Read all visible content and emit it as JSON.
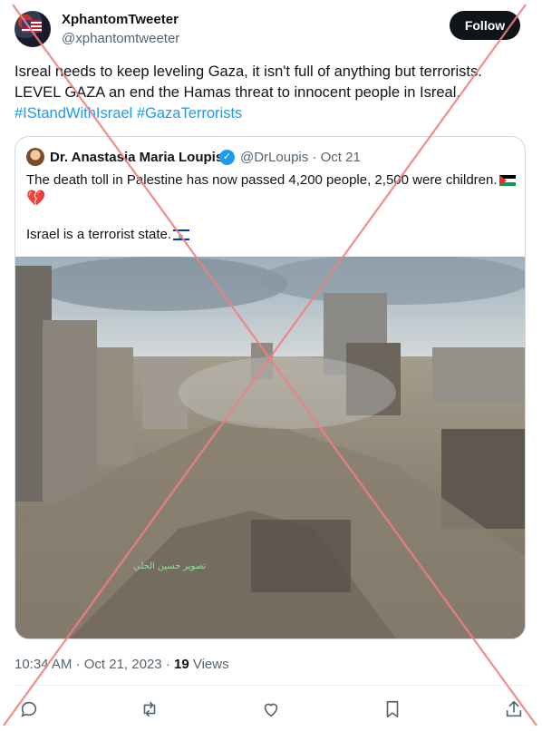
{
  "author": {
    "display_name": "XphantomTweeter",
    "handle": "@xphantomtweeter"
  },
  "follow_label": "Follow",
  "tweet": {
    "line1": "Isreal needs to keep leveling Gaza, it isn't full of anything but terrorists.",
    "line2": "LEVEL GAZA an end the Hamas threat to innocent people in Isreal.",
    "hashtags": [
      "#IStandWithIsrael",
      "#GazaTerrorists"
    ]
  },
  "quote": {
    "name": "Dr. Anastasia Maria Loupis",
    "handle": "@DrLoupis",
    "separator": "·",
    "date": "Oct 21",
    "text_line1": "The death toll in Palestine has now passed 4,200 people, 2,500 were children.",
    "text_line2": "Israel is a terrorist state.",
    "emojis": [
      "palestine-flag",
      "broken-heart",
      "israel-flag"
    ],
    "image_caption": "تصوير حسين الحلي"
  },
  "meta": {
    "time": "10:34 AM",
    "separator": "·",
    "date": "Oct 21, 2023",
    "views_count": "19",
    "views_label": "Views"
  },
  "actions": [
    "reply-icon",
    "retweet-icon",
    "like-icon",
    "bookmark-icon",
    "share-icon"
  ],
  "colors": {
    "accent": "#1d9bf0",
    "text": "#0f1419",
    "muted": "#536471",
    "follow_bg": "#0f1419",
    "cross_overlay": "#f08080"
  }
}
